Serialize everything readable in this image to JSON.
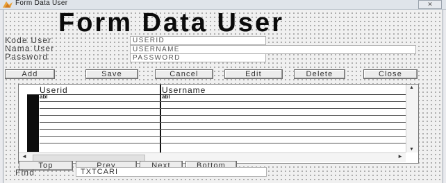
{
  "window": {
    "title": "Form Data User",
    "close_label": "✕"
  },
  "form": {
    "banner": "Form Data User"
  },
  "fields": [
    {
      "label": "Kode User",
      "value": "USERID"
    },
    {
      "label": "Nama User",
      "value": "USERNAME"
    },
    {
      "label": "Password",
      "value": "PASSWORD"
    }
  ],
  "buttons": {
    "add": "Add",
    "save": "Save",
    "cancel": "Cancel",
    "edit": "Edit",
    "delete": "Delete",
    "close": "Close"
  },
  "grid": {
    "columns": [
      "Userid",
      "Username"
    ],
    "cells": [
      "abl",
      "abl"
    ]
  },
  "nav": {
    "top": "Top",
    "prev": "Prev",
    "next": "Next",
    "bottom": "Bottom"
  },
  "find": {
    "label": "Find",
    "value": "TXTCARI"
  },
  "colors": {
    "banner": "#0b0b0b",
    "grid_marker": "#0d0d0d",
    "form_bg": "#f0f0f0"
  },
  "icons": {
    "app": "form-icon"
  }
}
